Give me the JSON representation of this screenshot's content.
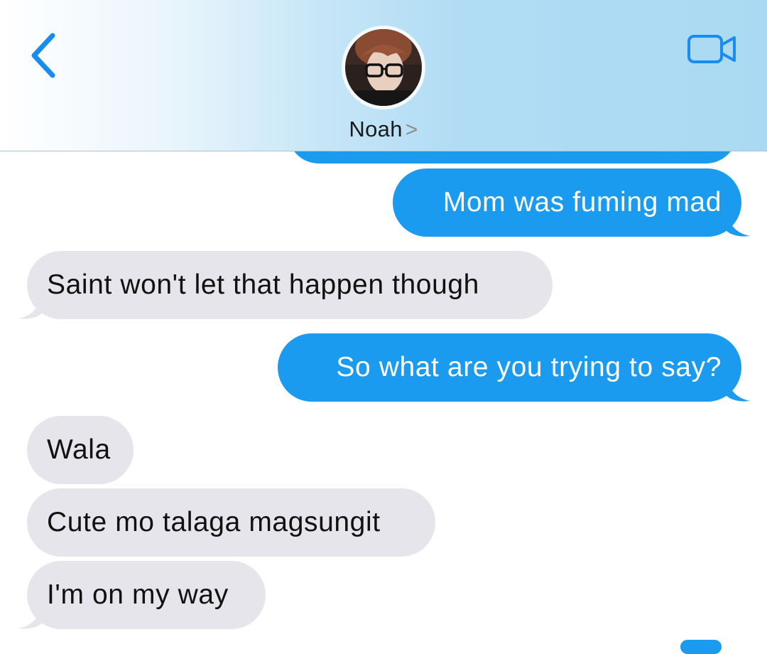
{
  "header": {
    "contact_name": "Noah",
    "chevron": ">",
    "back_icon": "chevron-left-icon",
    "video_icon": "video-camera-icon",
    "accent_color": "#1a9bf0"
  },
  "messages": [
    {
      "direction": "outgoing",
      "text": "Mom was fuming mad"
    },
    {
      "direction": "incoming",
      "text": "Saint won't let that happen though"
    },
    {
      "direction": "outgoing",
      "text": "So what are you trying to say?"
    },
    {
      "direction": "incoming",
      "text": "Wala"
    },
    {
      "direction": "incoming",
      "text": "Cute mo talaga magsungit"
    },
    {
      "direction": "incoming",
      "text": "I'm on my way"
    }
  ],
  "colors": {
    "outgoing_bubble": "#1a9bf0",
    "incoming_bubble": "#e6e5eb",
    "header_gradient_end": "#aadaf3"
  }
}
